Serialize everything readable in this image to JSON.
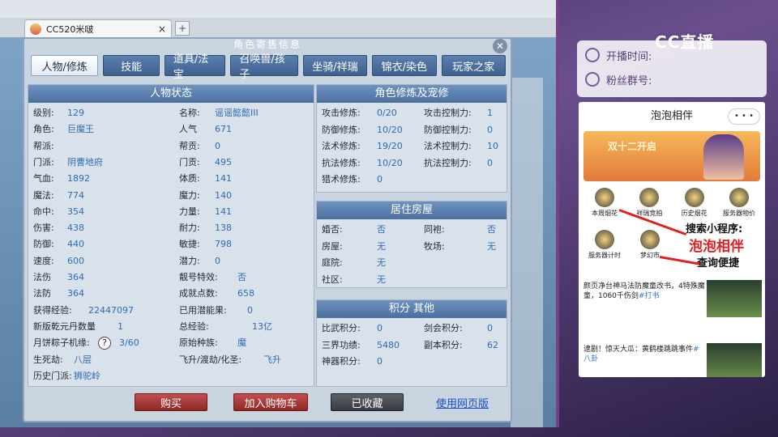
{
  "browser": {
    "tab_title": "CC520米啵",
    "tab_close": "×",
    "new_tab": "+"
  },
  "dialog": {
    "title": "角色寄售信息",
    "close": "✕",
    "tabs": [
      "人物/修炼",
      "技能",
      "道具/法宝",
      "召唤兽/孩子",
      "坐骑/祥瑞",
      "锦衣/染色",
      "玩家之家"
    ],
    "active_tab": 0
  },
  "status": {
    "header": "人物状态",
    "left": [
      {
        "label": "级别:",
        "value": "129"
      },
      {
        "label": "角色:",
        "value": "巨魔王"
      },
      {
        "label": "帮派:",
        "value": ""
      },
      {
        "label": "门派:",
        "value": "阴曹地府"
      },
      {
        "label": "气血:",
        "value": "1892"
      },
      {
        "label": "魔法:",
        "value": "774"
      },
      {
        "label": "命中:",
        "value": "354"
      },
      {
        "label": "伤害:",
        "value": "438"
      },
      {
        "label": "防御:",
        "value": "440"
      },
      {
        "label": "速度:",
        "value": "600"
      },
      {
        "label": "法伤",
        "value": "364"
      },
      {
        "label": "法防",
        "value": "364"
      },
      {
        "label": "获得经验:",
        "value": "22447097"
      },
      {
        "label": "新版乾元丹数量",
        "value": "1"
      },
      {
        "label": "月饼粽子机缘:",
        "value": "3/60"
      },
      {
        "label": "生死劫:",
        "value": "八层"
      },
      {
        "label": "历史门派:",
        "value": "狮驼岭"
      }
    ],
    "right": [
      {
        "label": "名称:",
        "value": "谣谣懿懿III"
      },
      {
        "label": "人气",
        "value": "671"
      },
      {
        "label": "帮贡:",
        "value": "0"
      },
      {
        "label": "门贡:",
        "value": "495"
      },
      {
        "label": "体质:",
        "value": "141"
      },
      {
        "label": "魔力:",
        "value": "140"
      },
      {
        "label": "力量:",
        "value": "141"
      },
      {
        "label": "耐力:",
        "value": "138"
      },
      {
        "label": "敏捷:",
        "value": "798"
      },
      {
        "label": "潜力:",
        "value": "0"
      },
      {
        "label": "靓号特效:",
        "value": "否"
      },
      {
        "label": "成就点数:",
        "value": "658"
      },
      {
        "label": "已用潜能果:",
        "value": "0"
      },
      {
        "label": "总经验:",
        "value": "13亿"
      },
      {
        "label": "原始种族:",
        "value": "魔"
      },
      {
        "label": "飞升/渡劫/化圣:",
        "value": "飞升"
      }
    ],
    "help": "?"
  },
  "cultivation": {
    "header": "角色修炼及宠修",
    "rows": [
      {
        "l1": "攻击修炼:",
        "v1": "0/20",
        "l2": "攻击控制力:",
        "v2": "1"
      },
      {
        "l1": "防御修炼:",
        "v1": "10/20",
        "l2": "防御控制力:",
        "v2": "0"
      },
      {
        "l1": "法术修炼:",
        "v1": "19/20",
        "l2": "法术控制力:",
        "v2": "10"
      },
      {
        "l1": "抗法修炼:",
        "v1": "10/20",
        "l2": "抗法控制力:",
        "v2": "0"
      },
      {
        "l1": "猎术修炼:",
        "v1": "0",
        "l2": "",
        "v2": ""
      }
    ]
  },
  "housing": {
    "header": "居住房屋",
    "rows": [
      {
        "l1": "婚否:",
        "v1": "否",
        "l2": "同袍:",
        "v2": "否"
      },
      {
        "l1": "房屋:",
        "v1": "无",
        "l2": "牧场:",
        "v2": "无"
      },
      {
        "l1": "庭院:",
        "v1": "无",
        "l2": "",
        "v2": ""
      },
      {
        "l1": "社区:",
        "v1": "无",
        "l2": "",
        "v2": ""
      }
    ]
  },
  "points": {
    "header": "积分 其他",
    "rows": [
      {
        "l1": "比武积分:",
        "v1": "0",
        "l2": "剑会积分:",
        "v2": "0"
      },
      {
        "l1": "三界功绩:",
        "v1": "5480",
        "l2": "副本积分:",
        "v2": "62"
      },
      {
        "l1": "神器积分:",
        "v1": "0",
        "l2": "",
        "v2": ""
      }
    ]
  },
  "actions": {
    "buy": "购买",
    "add_cart": "加入购物车",
    "favorited": "已收藏",
    "web_link": "使用网页版"
  },
  "overlay": {
    "cc_logo": "CC直播",
    "start_time_label": "开播时间:",
    "fans_group_label": "粉丝群号:"
  },
  "mini_program": {
    "title": "泡泡相伴",
    "dots": "• • •",
    "banner_text": "双十二开启",
    "icons": [
      "本周烟花",
      "祥瑞竞拍",
      "历史烟花",
      "服务器物价"
    ],
    "icons2": [
      "服务器计时",
      "梦幻市"
    ],
    "search_text": "搜索小程序:",
    "brand_text": "泡泡相伴",
    "query_text": "查询便捷",
    "news": [
      {
        "text": "颜页净台神马法防魔童改书，4特殊魔童，1060千伤剑",
        "tag": "#打书"
      },
      {
        "text": "逮剧！惊天大瓜：黄鹤楼跳跳事件",
        "tag": "#八卦"
      }
    ]
  }
}
